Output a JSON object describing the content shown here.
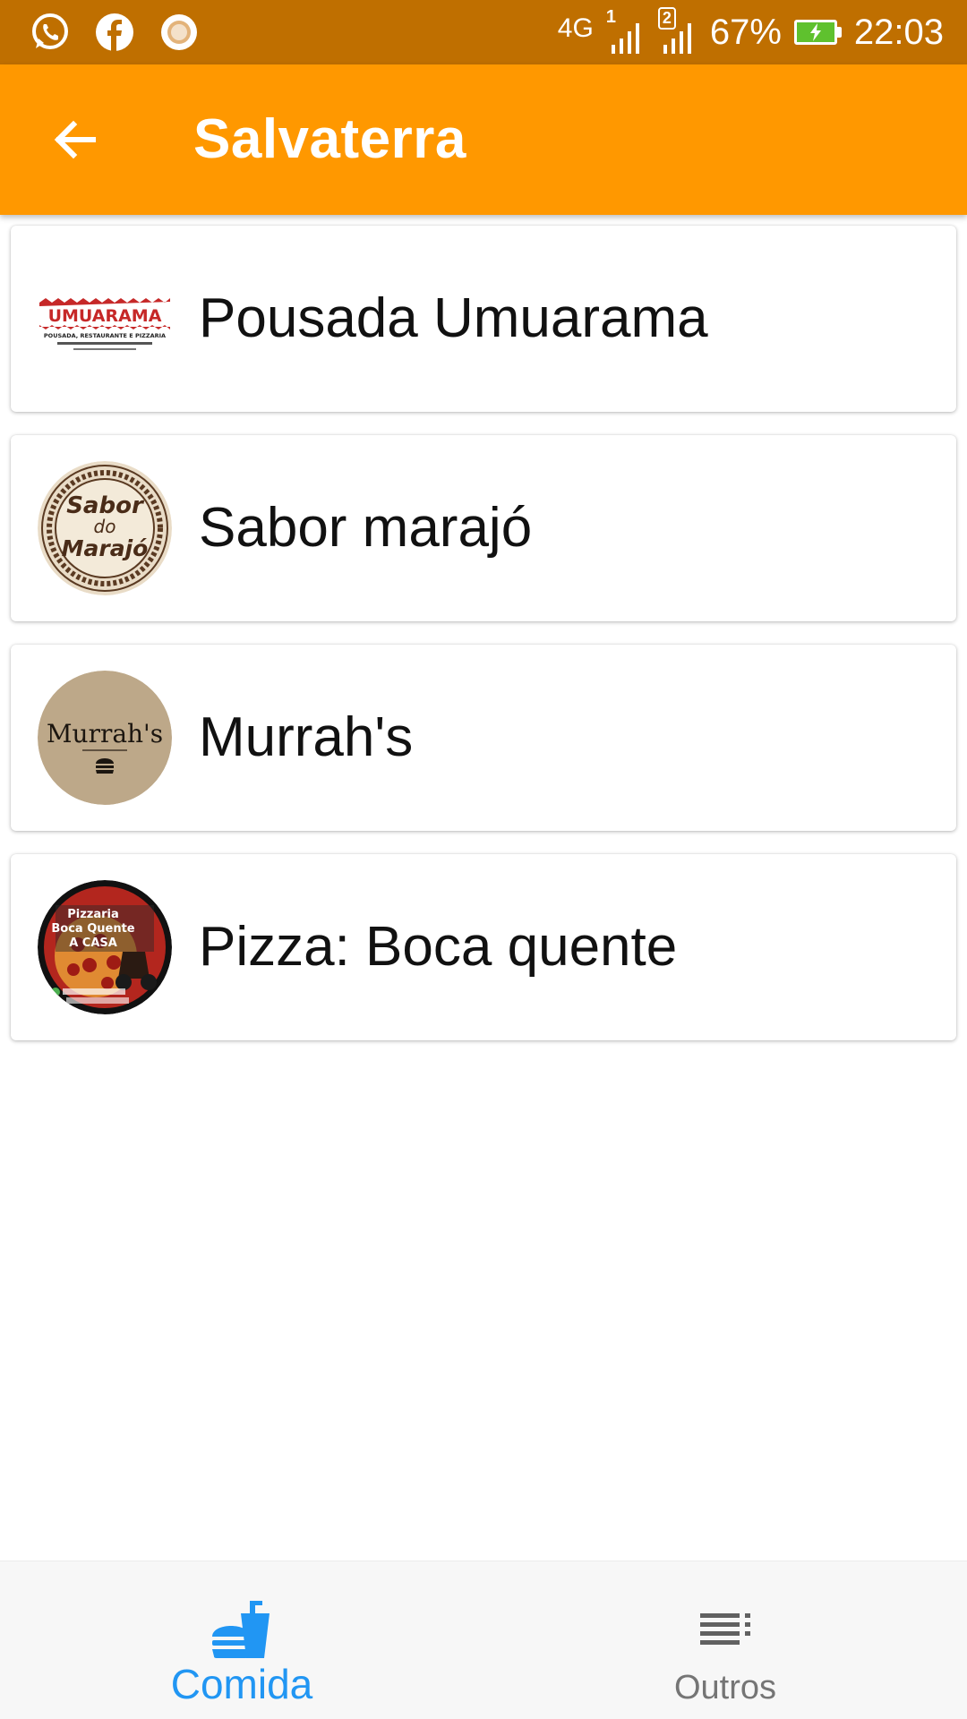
{
  "status_bar": {
    "left_icons": [
      "whatsapp-icon",
      "facebook-icon",
      "notification-dot-icon"
    ],
    "network": "4G",
    "sim1_label": "1",
    "sim2_label": "2",
    "battery_percent": "67%",
    "battery_level": 0.67,
    "time": "22:03"
  },
  "app_bar": {
    "title": "Salvaterra",
    "back_icon": "arrow-back-icon",
    "color": "#FF9800"
  },
  "restaurants": [
    {
      "name": "Pousada Umuarama",
      "logo_text": "UMUARAMA",
      "logo_subtext": "POUSADA, RESTAURANTE E PIZZARIA"
    },
    {
      "name": "Sabor marajó",
      "logo_text": "Sabor do Marajó"
    },
    {
      "name": "Murrah's",
      "logo_text": "Murrah's"
    },
    {
      "name": "Pizza: Boca quente",
      "logo_text": "Pizzaria Boca Quente A CASA"
    }
  ],
  "bottom_nav": {
    "items": [
      {
        "label": "Comida",
        "icon": "fastfood-icon",
        "active": true,
        "color": "#2196F3"
      },
      {
        "label": "Outros",
        "icon": "list-icon",
        "active": false,
        "color": "#757575"
      }
    ]
  }
}
